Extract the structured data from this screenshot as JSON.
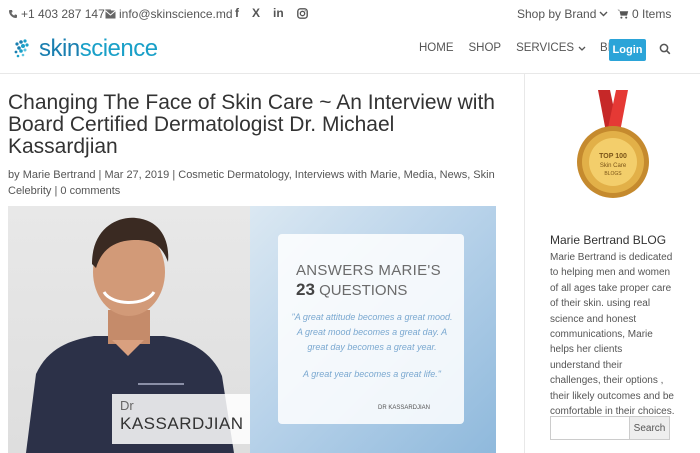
{
  "topbar": {
    "phone": "+1 403 287 1477",
    "email": "info@skinscience.md",
    "social": [
      "f",
      "X",
      "in",
      "instagram"
    ],
    "shop_by_brand": "Shop by Brand",
    "cart": "0 Items"
  },
  "header": {
    "logo": {
      "part1": "skin",
      "part2": "science"
    },
    "nav": [
      "HOME",
      "SHOP",
      "SERVICES",
      "BLOG"
    ],
    "login": "Login"
  },
  "post": {
    "title": "Changing The Face of Skin Care ~ An Interview with Board Certified Dermatologist Dr. Michael Kassardjian",
    "by": "by",
    "author": "Marie Bertrand",
    "date": "Mar 27, 2019",
    "categories": "Cosmetic Dermatology, Interviews with Marie, Media, News, Skin Celebrity",
    "comments": "0 comments"
  },
  "hero": {
    "head1": "ANSWERS MARIE'S",
    "num": "23",
    "head2": "QUESTIONS",
    "quote1": "\"A great attitude becomes a great mood. A great mood becomes a great day. A great day becomes a great year.",
    "quote2": "A great year becomes a great life.\"",
    "quote_author": "DR KASSARDJIAN",
    "tag1": "Dr",
    "tag2": "KASSARDJIAN"
  },
  "sidebar": {
    "badge": {
      "line1": "TOP 100",
      "line2": "Skin Care",
      "line3": "BLOGS"
    },
    "title": "Marie Bertrand BLOG",
    "text": "Marie Bertrand is dedicated to helping men and women of all ages take proper care of their skin. using real science and honest communications, Marie helps her clients understand their challenges, their options , their likely outcomes and be comfortable in their choices.",
    "search_button": "Search"
  },
  "colors": {
    "accent": "#2ba4d8",
    "logo": "#1aa0c8",
    "badge_ribbon": "#c62828",
    "badge_gold": "#d9a441"
  }
}
